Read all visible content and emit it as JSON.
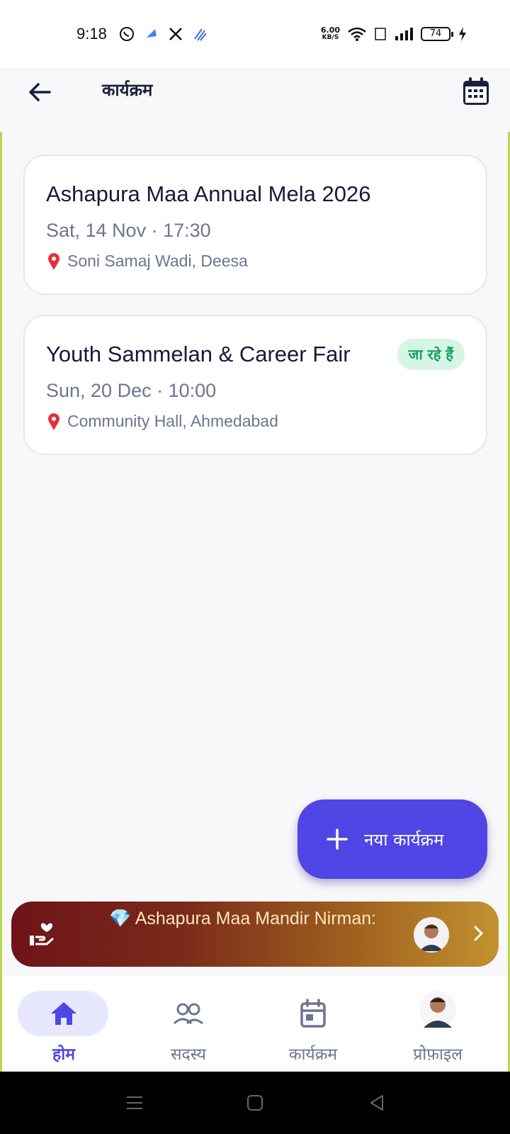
{
  "status_bar": {
    "time": "9:18",
    "speed_value": "6.00",
    "speed_unit": "KB/S",
    "battery": "74"
  },
  "header": {
    "title": "कार्यक्रम"
  },
  "events": [
    {
      "title": "Ashapura Maa Annual Mela 2026",
      "datetime": "Sat, 14 Nov · 17:30",
      "location": "Soni Samaj Wadi, Deesa"
    },
    {
      "title": "Youth Sammelan & Career Fair",
      "datetime": "Sun, 20 Dec · 10:00",
      "location": "Community Hall, Ahmedabad",
      "badge": "जा रहे हैं",
      "badge_color": "#14a05a"
    }
  ],
  "fab": {
    "label": "नया कार्यक्रम"
  },
  "banner": {
    "text": "💎 Ashapura Maa Mandir Nirman:"
  },
  "bottom_nav": {
    "items": [
      {
        "label": "होम",
        "icon": "home-icon",
        "active": true
      },
      {
        "label": "सदस्य",
        "icon": "people-icon",
        "active": false
      },
      {
        "label": "कार्यक्रम",
        "icon": "calendar-icon",
        "active": false
      },
      {
        "label": "प्रोफ़ाइल",
        "icon": "profile-avatar",
        "active": false
      }
    ]
  },
  "colors": {
    "accent": "#4f46e5",
    "badge_bg": "#d6f5e6"
  }
}
